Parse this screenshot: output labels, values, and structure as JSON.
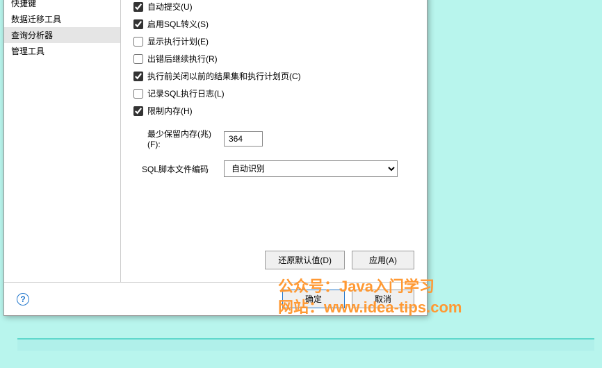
{
  "sidebar": {
    "items": [
      {
        "label": "快捷键"
      },
      {
        "label": "数据迁移工具"
      },
      {
        "label": "查询分析器"
      },
      {
        "label": "管理工具"
      }
    ]
  },
  "options": {
    "auto_commit": "自动提交(U)",
    "enable_sql_escape": "启用SQL转义(S)",
    "show_exec_plan": "显示执行计划(E)",
    "continue_on_error": "出错后继续执行(R)",
    "close_prev_results": "执行前关闭以前的结果集和执行计划页(C)",
    "log_sql_exec": "记录SQL执行日志(L)",
    "limit_memory": "限制内存(H)"
  },
  "form": {
    "min_memory_label": "最少保留内存(兆)(F):",
    "min_memory_value": "364",
    "encoding_label": "SQL脚本文件编码",
    "encoding_value": "自动识别"
  },
  "buttons": {
    "restore_default": "还原默认值(D)",
    "apply": "应用(A)",
    "ok": "确定",
    "cancel": "取消"
  },
  "watermark": {
    "line1": "公众号：Java入门学习",
    "line2": "网站：www.idea-tips.com"
  }
}
